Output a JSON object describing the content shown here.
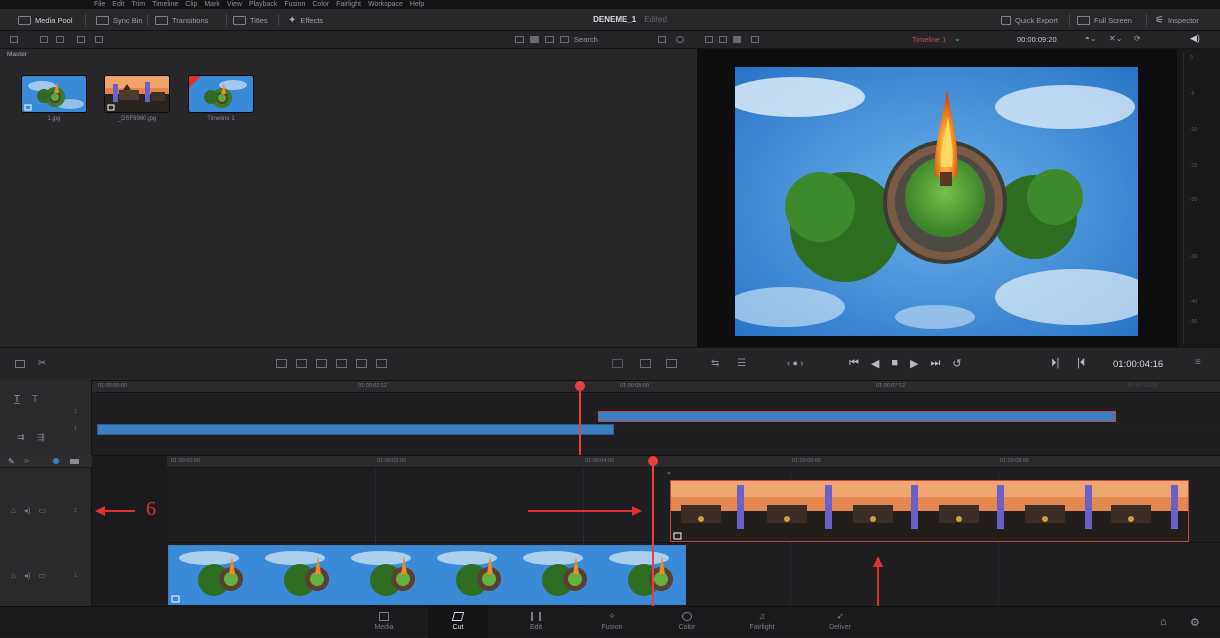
{
  "menu": [
    "File",
    "Edit",
    "Trim",
    "Timeline",
    "Clip",
    "Mark",
    "View",
    "Playback",
    "Fusion",
    "Color",
    "Fairlight",
    "Workspace",
    "Help"
  ],
  "toolbar": {
    "media_pool": "Media Pool",
    "sync_bin": "Sync Bin",
    "transitions": "Transitions",
    "titles": "Titles",
    "effects": "Effects",
    "project_name": "DENEME_1",
    "project_status": "Edited",
    "quick_export": "Quick Export",
    "full_screen": "Full Screen",
    "inspector": "Inspector"
  },
  "pool": {
    "search_label": "Search",
    "bin_label": "Master",
    "clips": [
      {
        "name": "1.jpg",
        "kind": "image"
      },
      {
        "name": "_DSF9980.jpg",
        "kind": "image"
      },
      {
        "name": "Timeline 1",
        "kind": "timeline"
      }
    ]
  },
  "viewer": {
    "timeline_name": "Timeline 1",
    "duration": "00:00:09:20",
    "meter_labels": [
      "0",
      "-5",
      "-10",
      "-15",
      "-20",
      "-30",
      "-40",
      "-50"
    ]
  },
  "transport": {
    "timecode": "01:00:04:16"
  },
  "upper_timeline": {
    "ruler": [
      "01:00:00:00",
      "01:00:02:12",
      "01:00:05:00",
      "01:00:07:12",
      "01:00:10:00"
    ],
    "track_numbers": [
      "2",
      "1"
    ]
  },
  "lower_timeline": {
    "ruler": [
      "01:00:00:00",
      "01:00:02:00",
      "01:00:04:00",
      "01:00:06:00",
      "01:00:08:00"
    ],
    "track_numbers": [
      "2",
      "1"
    ]
  },
  "annotation": {
    "label": "6"
  },
  "pages": [
    "Media",
    "Cut",
    "Edit",
    "Fusion",
    "Color",
    "Fairlight",
    "Deliver"
  ],
  "colors": {
    "accent_red": "#e03030",
    "clip_blue": "#3a7fc0",
    "playhead": "#e84040"
  }
}
